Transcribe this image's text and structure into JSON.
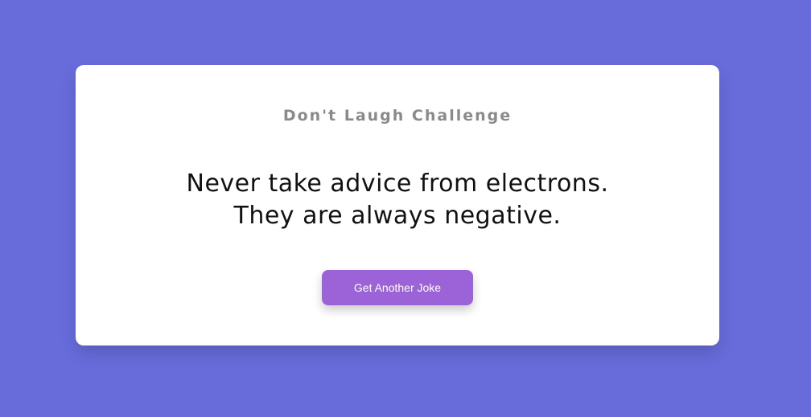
{
  "card": {
    "title": "Don't Laugh Challenge",
    "joke": "Never take advice from electrons. They are always negative.",
    "button_label": "Get Another Joke"
  },
  "colors": {
    "background": "#686cdb",
    "card": "#ffffff",
    "button": "#9c63d8",
    "title_text": "#8a8a8a"
  }
}
